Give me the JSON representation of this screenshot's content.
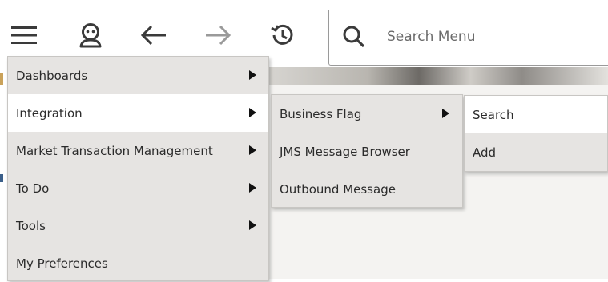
{
  "toolbar": {
    "icons": [
      "hamburger-menu-icon",
      "user-icon",
      "back-arrow-icon",
      "forward-arrow-icon",
      "history-icon"
    ]
  },
  "search": {
    "placeholder": "Search Menu",
    "icon": "search-icon"
  },
  "main_menu": {
    "items": [
      {
        "label": "Dashboards",
        "has_submenu": true
      },
      {
        "label": "Integration",
        "has_submenu": true,
        "active": true
      },
      {
        "label": "Market Transaction Management",
        "has_submenu": true
      },
      {
        "label": "To Do",
        "has_submenu": true
      },
      {
        "label": "Tools",
        "has_submenu": true
      },
      {
        "label": "My Preferences",
        "has_submenu": false
      }
    ]
  },
  "integration_menu": {
    "items": [
      {
        "label": "Business Flag",
        "has_submenu": true
      },
      {
        "label": "JMS Message Browser",
        "has_submenu": false
      },
      {
        "label": "Outbound Message",
        "has_submenu": false
      }
    ]
  },
  "business_flag_menu": {
    "items": [
      {
        "label": "Search",
        "active": true
      },
      {
        "label": "Add"
      }
    ]
  },
  "colors": {
    "menu_bg": "#e6e4e2",
    "menu_active_bg": "#ffffff",
    "icon": "#3a3a3a",
    "icon_disabled": "#9a9a9a"
  }
}
